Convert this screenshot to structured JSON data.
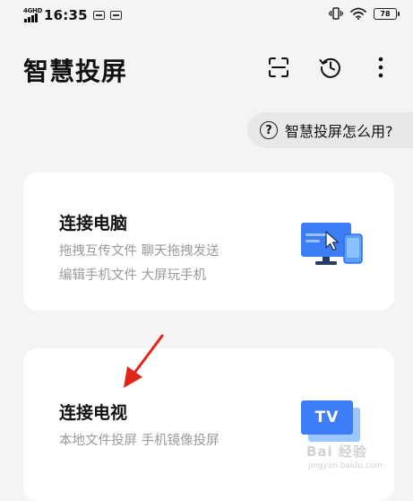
{
  "status_bar": {
    "network": "4GHD",
    "time": "16:35",
    "battery": "78"
  },
  "header": {
    "title": "智慧投屏"
  },
  "help": {
    "label": "智慧投屏怎么用?"
  },
  "cards": [
    {
      "title": "连接电脑",
      "lines": [
        "拖拽互传文件  聊天拖拽发送",
        "编辑手机文件  大屏玩手机"
      ]
    },
    {
      "title": "连接电视",
      "lines": [
        "本地文件投屏  手机镜像投屏"
      ],
      "badge": "TV"
    }
  ],
  "watermark": {
    "main": "Bai 经验",
    "sub": "jingyan.baidu.com"
  },
  "colors": {
    "accent": "#3d7df5",
    "accent_light": "#7fb0ff",
    "annotation_arrow": "#e0251b"
  }
}
